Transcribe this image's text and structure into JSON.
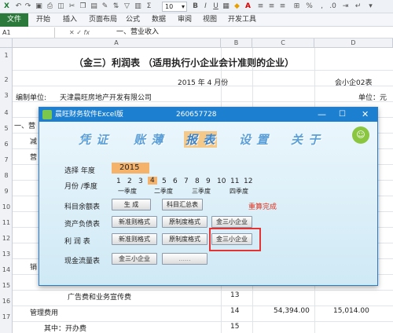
{
  "qat": {
    "font_size": "10"
  },
  "ribbon": {
    "file": "文件",
    "tabs": [
      "开始",
      "插入",
      "页面布局",
      "公式",
      "数据",
      "审阅",
      "视图",
      "开发工具"
    ]
  },
  "formula_bar": {
    "name_box": "A1",
    "content": "一、营业收入"
  },
  "columns": [
    "A",
    "B",
    "C",
    "D"
  ],
  "rows": [
    "1",
    "2",
    "3",
    "4",
    "5",
    "6",
    "7",
    "8",
    "9",
    "10",
    "11",
    "12",
    "13",
    "14",
    "15",
    "16",
    "17",
    "18",
    "19"
  ],
  "sheet": {
    "title": "（金三）利润表  （适用执行小企业会计准则的企业）",
    "date": "2015 年 4 月份",
    "form_no": "会小企02表",
    "company_label": "编制单位:",
    "company": "天津晨旺房地产开发有限公司",
    "unit": "单位：元",
    "r4a": "一、营",
    "r5a": "减",
    "r6a": "营",
    "r12a": "销",
    "r17a": "广告费和业务宣传费",
    "r17b": "13",
    "r18a": "管理费用",
    "r18b": "14",
    "r18c": "54,394.00",
    "r18d": "15,014.00",
    "r19a": "其中：开办费",
    "r19b": "15"
  },
  "dialog": {
    "title": "晨旺财务软件Excel版",
    "code": "260657728",
    "menu": [
      "凭 证",
      "账 薄",
      "报 表",
      "设 置",
      "关 于"
    ],
    "year_label": "选择  年度",
    "year": "2015",
    "month_label": "月份 /季度",
    "months": [
      "1",
      "2",
      "3",
      "4",
      "5",
      "6",
      "7",
      "8",
      "9",
      "10",
      "11",
      "12"
    ],
    "quarters": [
      "一季度",
      "二季度",
      "三季度",
      "四季度"
    ],
    "r1_label": "科目余额表",
    "r1_btn1": "生  成",
    "r1_btn2": "科目汇总表",
    "r1_status": "重算完成",
    "r2_label": "资产负债表",
    "r2_btn1": "新准则格式",
    "r2_btn2": "原制度格式",
    "r2_btn3": "金三小企业",
    "r3_label": "利  润  表",
    "r3_btn1": "新准则格式",
    "r3_btn2": "原制度格式",
    "r3_btn3": "金三小企业",
    "r4_label": "现金流量表",
    "r4_btn1": "金三小企业",
    "r4_btn2": "......",
    "colors": {
      "title_bar": "#1c7fd0",
      "year_bg": "#f5b26b",
      "status": "#e0301e",
      "highlight": "#e33333"
    }
  }
}
